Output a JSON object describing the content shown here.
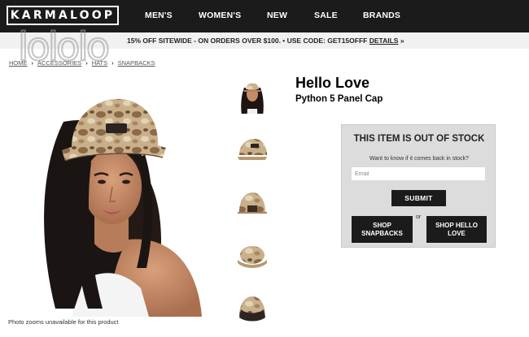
{
  "header": {
    "logo": "KARMALOOP",
    "nav": [
      "MEN'S",
      "WOMEN'S",
      "NEW",
      "SALE",
      "BRANDS"
    ]
  },
  "promo": {
    "text": "15% OFF SITEWIDE - ON ORDERS OVER $100. • USE CODE: GET15OFFF",
    "details": "DETAILS",
    "arrow": "»"
  },
  "watermark": "lololo",
  "breadcrumb": [
    "HOME",
    "ACCESSORIES",
    "HATS",
    "SNAPBACKS"
  ],
  "breadcrumb_separator": "›",
  "product": {
    "title": "Hello Love",
    "subtitle": "Python 5 Panel Cap",
    "photo_caption": "Photo zooms unavailable for this product",
    "thumbnail_icons": [
      "model-wearing-cap-thumbnail",
      "cap-side-thumbnail",
      "cap-back-thumbnail",
      "cap-top-thumbnail",
      "cap-underbrim-thumbnail"
    ]
  },
  "stock": {
    "heading": "THIS ITEM IS OUT OF STOCK",
    "question": "Want to know if it comes back in stock?",
    "email_placeholder": "Email",
    "submit": "SUBMIT",
    "or": "or",
    "shop_snapbacks": [
      "SHOP",
      "SNAPBACKS"
    ],
    "shop_brand": [
      "SHOP HELLO",
      "LOVE"
    ]
  },
  "colors": {
    "nav_bg": "#1b1b1b",
    "panel_bg": "#dcdcdc",
    "camo_tan": "#c9b08a",
    "camo_brown": "#7a5f43"
  }
}
